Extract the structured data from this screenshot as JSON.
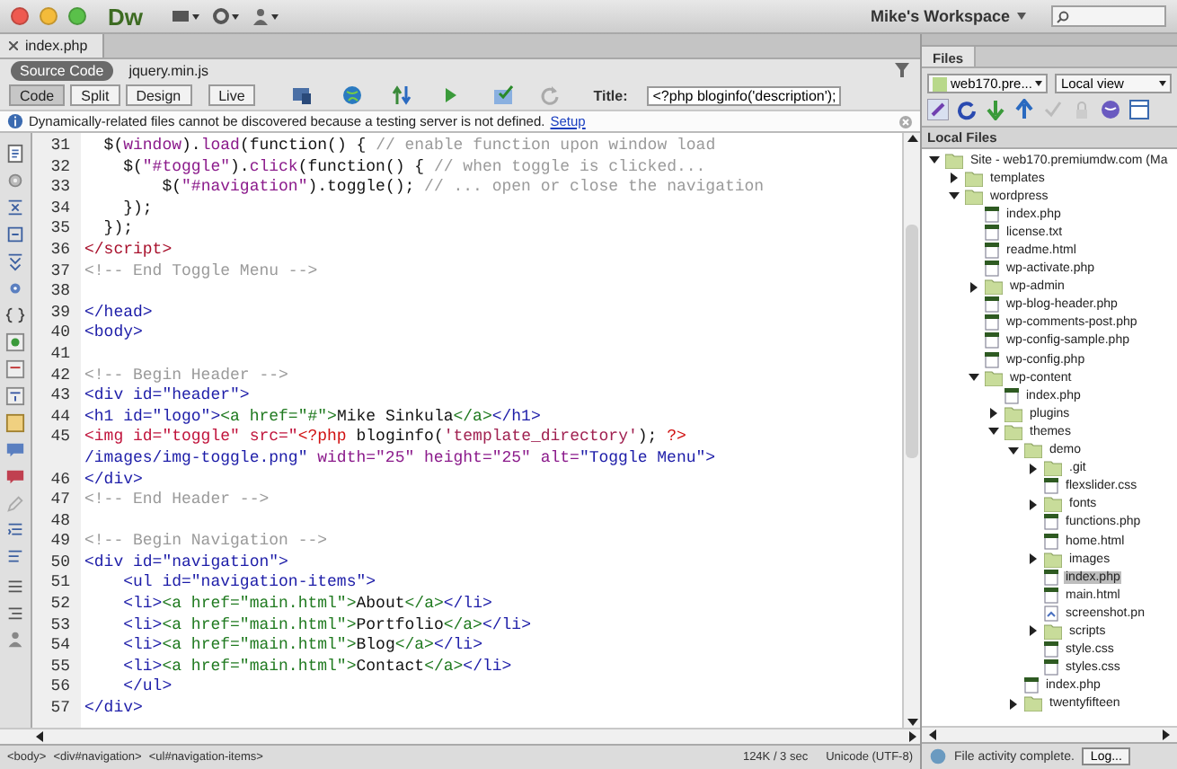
{
  "window": {
    "app_logo": "Dw",
    "workspace": "Mike's Workspace"
  },
  "document_tabs": [
    {
      "label": "index.php",
      "selected": true
    }
  ],
  "related_files": [
    {
      "label": "Source Code",
      "selected": true
    },
    {
      "label": "jquery.min.js",
      "selected": false
    }
  ],
  "view_buttons": [
    {
      "label": "Code",
      "selected": true
    },
    {
      "label": "Split",
      "selected": false
    },
    {
      "label": "Design",
      "selected": false
    },
    {
      "label": "Live",
      "selected": false
    }
  ],
  "title_field": {
    "label": "Title:",
    "value": "<?php bloginfo('description');"
  },
  "info_bar": {
    "message": "Dynamically-related files cannot be discovered because a testing server is not defined.",
    "link": "Setup"
  },
  "code_lines": [
    {
      "number": "31",
      "segments": [
        {
          "kind": "plain",
          "text": "  $("
        },
        {
          "kind": "js",
          "text": "window"
        },
        {
          "kind": "plain",
          "text": ")."
        },
        {
          "kind": "js",
          "text": "load"
        },
        {
          "kind": "plain",
          "text": "(function() { "
        },
        {
          "kind": "comment",
          "text": "// enable function upon window load"
        }
      ]
    },
    {
      "number": "32",
      "segments": [
        {
          "kind": "plain",
          "text": "    $("
        },
        {
          "kind": "js",
          "text": "\"#toggle\""
        },
        {
          "kind": "plain",
          "text": ")."
        },
        {
          "kind": "js",
          "text": "click"
        },
        {
          "kind": "plain",
          "text": "(function() { "
        },
        {
          "kind": "comment",
          "text": "// when toggle is clicked..."
        }
      ]
    },
    {
      "number": "33",
      "segments": [
        {
          "kind": "plain",
          "text": "        $("
        },
        {
          "kind": "js",
          "text": "\"#navigation\""
        },
        {
          "kind": "plain",
          "text": ").toggle(); "
        },
        {
          "kind": "comment",
          "text": "// ... open or close the navigation"
        }
      ]
    },
    {
      "number": "34",
      "segments": [
        {
          "kind": "plain",
          "text": "    });"
        }
      ]
    },
    {
      "number": "35",
      "segments": [
        {
          "kind": "plain",
          "text": "  });"
        }
      ]
    },
    {
      "number": "36",
      "segments": [
        {
          "kind": "script",
          "text": "</script>"
        }
      ]
    },
    {
      "number": "37",
      "segments": [
        {
          "kind": "comment",
          "text": "<!-- End Toggle Menu -->"
        }
      ]
    },
    {
      "number": "38"
    },
    {
      "number": "39",
      "segments": [
        {
          "kind": "tag",
          "text": "</head>"
        }
      ]
    },
    {
      "number": "40",
      "segments": [
        {
          "kind": "tag",
          "text": "<body>"
        }
      ]
    },
    {
      "number": "41"
    },
    {
      "number": "42",
      "segments": [
        {
          "kind": "comment",
          "text": "<!-- Begin Header -->"
        }
      ]
    },
    {
      "number": "43",
      "segments": [
        {
          "kind": "tag",
          "text": "<div id=\"header\">"
        }
      ]
    },
    {
      "number": "44",
      "segments": [
        {
          "kind": "tag",
          "text": "<h1 id=\"logo\">"
        },
        {
          "kind": "anchor",
          "text": "<a href=\"#\">"
        },
        {
          "kind": "plain",
          "text": "Mike Sinkula"
        },
        {
          "kind": "anchor",
          "text": "</a>"
        },
        {
          "kind": "tag",
          "text": "</h1>"
        }
      ]
    },
    {
      "number": "45",
      "segments": [
        {
          "kind": "img",
          "text": "<img id=\"toggle\" src=\""
        },
        {
          "kind": "php",
          "text": "<?php"
        },
        {
          "kind": "plain",
          "text": " bloginfo("
        },
        {
          "kind": "phpstr",
          "text": "'template_directory'"
        },
        {
          "kind": "plain",
          "text": "); "
        },
        {
          "kind": "php",
          "text": "?>"
        }
      ]
    },
    {
      "segments": [
        {
          "kind": "tag",
          "text": "/images/img-toggle.png\" "
        },
        {
          "kind": "attr",
          "text": "width=\"25\" height=\"25\" alt="
        },
        {
          "kind": "tag",
          "text": "\"Toggle Menu\">"
        }
      ]
    },
    {
      "number": "46",
      "segments": [
        {
          "kind": "tag",
          "text": "</div>"
        }
      ]
    },
    {
      "number": "47",
      "segments": [
        {
          "kind": "comment",
          "text": "<!-- End Header -->"
        }
      ]
    },
    {
      "number": "48"
    },
    {
      "number": "49",
      "segments": [
        {
          "kind": "comment",
          "text": "<!-- Begin Navigation -->"
        }
      ]
    },
    {
      "number": "50",
      "segments": [
        {
          "kind": "tag",
          "text": "<div id=\"navigation\">"
        }
      ]
    },
    {
      "number": "51",
      "segments": [
        {
          "kind": "tag",
          "text": "    <ul id=\"navigation-items\">"
        }
      ]
    },
    {
      "number": "52",
      "segments": [
        {
          "kind": "tag",
          "text": "    <li>"
        },
        {
          "kind": "anchor",
          "text": "<a href=\"main.html\">"
        },
        {
          "kind": "plain",
          "text": "About"
        },
        {
          "kind": "anchor",
          "text": "</a>"
        },
        {
          "kind": "tag",
          "text": "</li>"
        }
      ]
    },
    {
      "number": "53",
      "segments": [
        {
          "kind": "tag",
          "text": "    <li>"
        },
        {
          "kind": "anchor",
          "text": "<a href=\"main.html\">"
        },
        {
          "kind": "plain",
          "text": "Portfolio"
        },
        {
          "kind": "anchor",
          "text": "</a>"
        },
        {
          "kind": "tag",
          "text": "</li>"
        }
      ]
    },
    {
      "number": "54",
      "segments": [
        {
          "kind": "tag",
          "text": "    <li>"
        },
        {
          "kind": "anchor",
          "text": "<a href=\"main.html\">"
        },
        {
          "kind": "plain",
          "text": "Blog"
        },
        {
          "kind": "anchor",
          "text": "</a>"
        },
        {
          "kind": "tag",
          "text": "</li>"
        }
      ]
    },
    {
      "number": "55",
      "segments": [
        {
          "kind": "tag",
          "text": "    <li>"
        },
        {
          "kind": "anchor",
          "text": "<a href=\"main.html\">"
        },
        {
          "kind": "plain",
          "text": "Contact"
        },
        {
          "kind": "anchor",
          "text": "</a>"
        },
        {
          "kind": "tag",
          "text": "</li>"
        }
      ]
    },
    {
      "number": "56",
      "segments": [
        {
          "kind": "tag",
          "text": "    </ul>"
        }
      ]
    },
    {
      "number": "57",
      "segments": [
        {
          "kind": "tag",
          "text": "</div>"
        }
      ]
    }
  ],
  "status_bar": {
    "tag_selector": [
      "<body>",
      "<div#navigation>",
      "<ul#navigation-items>"
    ],
    "download_stats": "124K / 3 sec",
    "encoding": "Unicode (UTF-8)"
  },
  "files_panel": {
    "tab": "Files",
    "site_dropdown": "web170.pre...",
    "view_dropdown": "Local view",
    "header": "Local Files",
    "status": "File activity complete.",
    "log_button": "Log...",
    "tree": [
      {
        "name": "Site - web170.premiumdw.com (Ma",
        "kind": "site",
        "expanded": true,
        "selected": false,
        "children": [
          {
            "name": "templates",
            "kind": "folder",
            "expanded": false,
            "selected": false
          },
          {
            "name": "wordpress",
            "kind": "folder",
            "expanded": true,
            "selected": false,
            "children": [
              {
                "name": "index.php",
                "kind": "file",
                "selected": false
              },
              {
                "name": "license.txt",
                "kind": "file",
                "selected": false
              },
              {
                "name": "readme.html",
                "kind": "file",
                "selected": false
              },
              {
                "name": "wp-activate.php",
                "kind": "file",
                "selected": false
              },
              {
                "name": "wp-admin",
                "kind": "folder",
                "expanded": false,
                "selected": false
              },
              {
                "name": "wp-blog-header.php",
                "kind": "file",
                "selected": false
              },
              {
                "name": "wp-comments-post.php",
                "kind": "file",
                "selected": false
              },
              {
                "name": "wp-config-sample.php",
                "kind": "file",
                "selected": false
              },
              {
                "name": "wp-config.php",
                "kind": "file",
                "selected": false
              },
              {
                "name": "wp-content",
                "kind": "folder",
                "expanded": true,
                "selected": false,
                "children": [
                  {
                    "name": "index.php",
                    "kind": "file",
                    "selected": false
                  },
                  {
                    "name": "plugins",
                    "kind": "folder",
                    "expanded": false,
                    "selected": false
                  },
                  {
                    "name": "themes",
                    "kind": "folder",
                    "expanded": true,
                    "selected": false,
                    "children": [
                      {
                        "name": "demo",
                        "kind": "folder",
                        "expanded": true,
                        "selected": false,
                        "children": [
                          {
                            "name": ".git",
                            "kind": "folder",
                            "expanded": false,
                            "selected": false
                          },
                          {
                            "name": "flexslider.css",
                            "kind": "file",
                            "selected": false
                          },
                          {
                            "name": "fonts",
                            "kind": "folder",
                            "expanded": false,
                            "selected": false
                          },
                          {
                            "name": "functions.php",
                            "kind": "file",
                            "selected": false
                          },
                          {
                            "name": "home.html",
                            "kind": "file",
                            "selected": false
                          },
                          {
                            "name": "images",
                            "kind": "folder",
                            "expanded": false,
                            "selected": false
                          },
                          {
                            "name": "index.php",
                            "kind": "file",
                            "selected": true
                          },
                          {
                            "name": "main.html",
                            "kind": "file",
                            "selected": false
                          },
                          {
                            "name": "screenshot.pn",
                            "kind": "image",
                            "selected": false
                          },
                          {
                            "name": "scripts",
                            "kind": "folder",
                            "expanded": false,
                            "selected": false
                          },
                          {
                            "name": "style.css",
                            "kind": "file",
                            "selected": false
                          },
                          {
                            "name": "styles.css",
                            "kind": "file",
                            "selected": false
                          }
                        ]
                      },
                      {
                        "name": "index.php",
                        "kind": "file",
                        "selected": false
                      },
                      {
                        "name": "twentyfifteen",
                        "kind": "folder",
                        "expanded": false,
                        "selected": false
                      }
                    ]
                  }
                ]
              }
            ]
          }
        ]
      }
    ]
  }
}
